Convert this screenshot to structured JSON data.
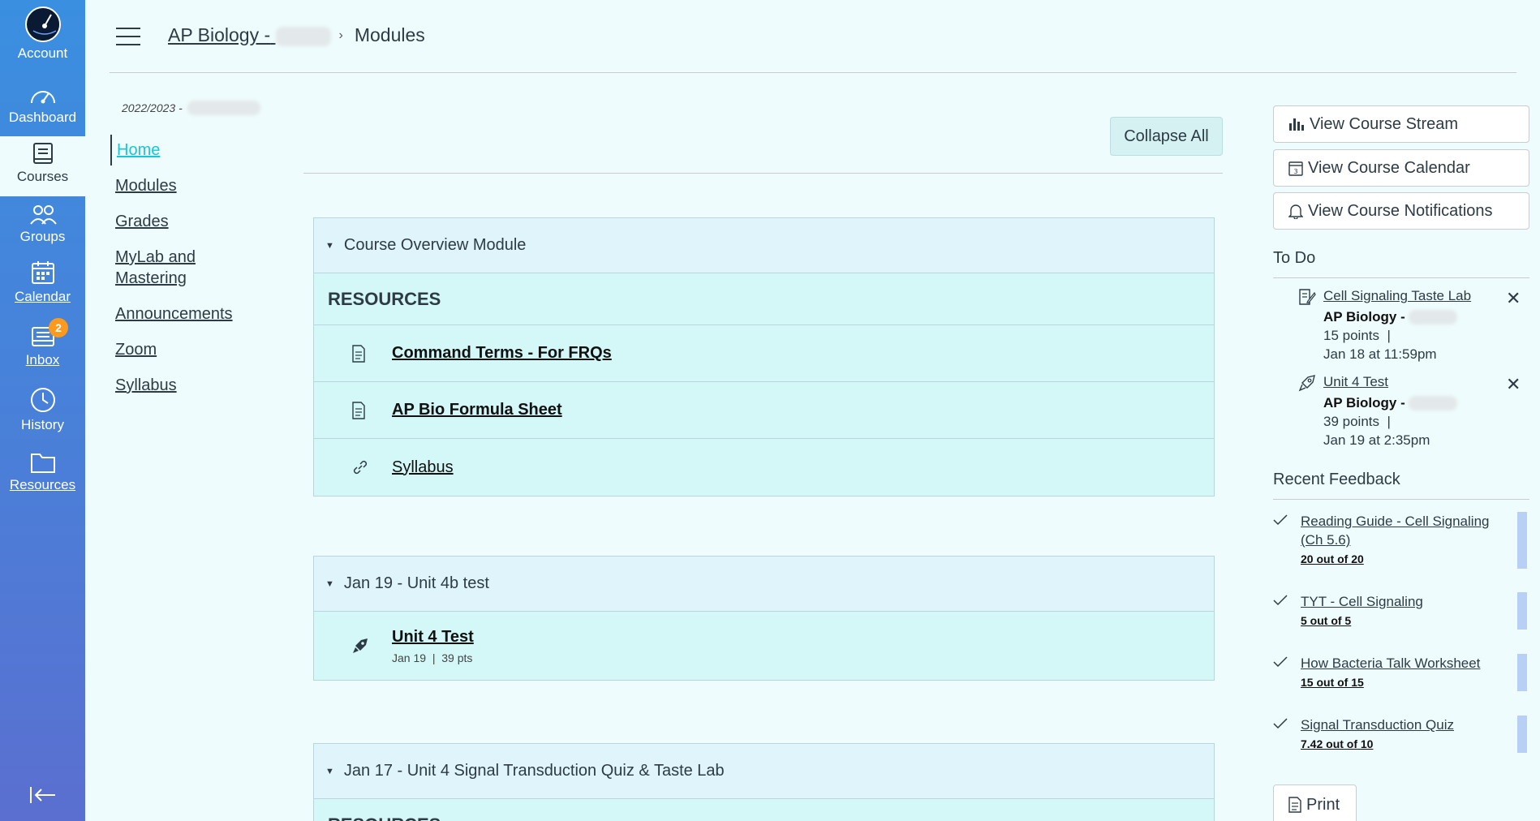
{
  "global_nav": {
    "account": "Account",
    "dashboard": "Dashboard",
    "courses": "Courses",
    "groups": "Groups",
    "calendar": "Calendar",
    "inbox": "Inbox",
    "inbox_badge": "2",
    "history": "History",
    "resources": "Resources"
  },
  "breadcrumb": {
    "course": "AP Biology -",
    "current": "Modules"
  },
  "course_nav": {
    "term": "2022/2023 -",
    "items": [
      {
        "label": "Home"
      },
      {
        "label": "Modules"
      },
      {
        "label": "Grades"
      },
      {
        "label": "MyLab and Mastering"
      },
      {
        "label": "Announcements"
      },
      {
        "label": "Zoom"
      },
      {
        "label": "Syllabus"
      }
    ]
  },
  "main": {
    "collapse_all": "Collapse All",
    "modules": [
      {
        "title": "Course Overview Module",
        "subheader": "RESOURCES",
        "items": [
          {
            "title": "Command Terms - For FRQs",
            "icon": "document-icon"
          },
          {
            "title": "AP Bio Formula Sheet",
            "icon": "document-icon"
          },
          {
            "title": "Syllabus",
            "icon": "link-icon"
          }
        ]
      },
      {
        "title": "Jan 19 - Unit 4b test",
        "items": [
          {
            "title": "Unit 4 Test",
            "icon": "quiz-rocket-icon",
            "date": "Jan 19",
            "pts": "39 pts"
          }
        ]
      },
      {
        "title": "Jan 17 - Unit 4 Signal Transduction Quiz & Taste Lab",
        "subheader": "RESOURCES"
      }
    ]
  },
  "sidebar": {
    "view_stream": "View Course Stream",
    "view_calendar": "View Course Calendar",
    "view_notifications": "View Course Notifications",
    "todo_heading": "To Do",
    "todos": [
      {
        "title": "Cell Signaling Taste Lab",
        "course": "AP Biology -",
        "points": "15 points",
        "date": "Jan 18 at 11:59pm",
        "icon": "assignment-icon"
      },
      {
        "title": "Unit 4 Test",
        "course": "AP Biology -",
        "points": "39 points",
        "date": "Jan 19 at 2:35pm",
        "icon": "quiz-rocket-icon"
      }
    ],
    "feedback_heading": "Recent Feedback",
    "feedback": [
      {
        "title": "Reading Guide - Cell Signaling (Ch 5.6)",
        "score": "20 out of 20"
      },
      {
        "title": "TYT - Cell Signaling",
        "score": "5 out of 5"
      },
      {
        "title": "How Bacteria Talk Worksheet",
        "score": "15 out of 15"
      },
      {
        "title": "Signal Transduction Quiz",
        "score": "7.42 out of 10"
      }
    ],
    "print": "Print"
  }
}
